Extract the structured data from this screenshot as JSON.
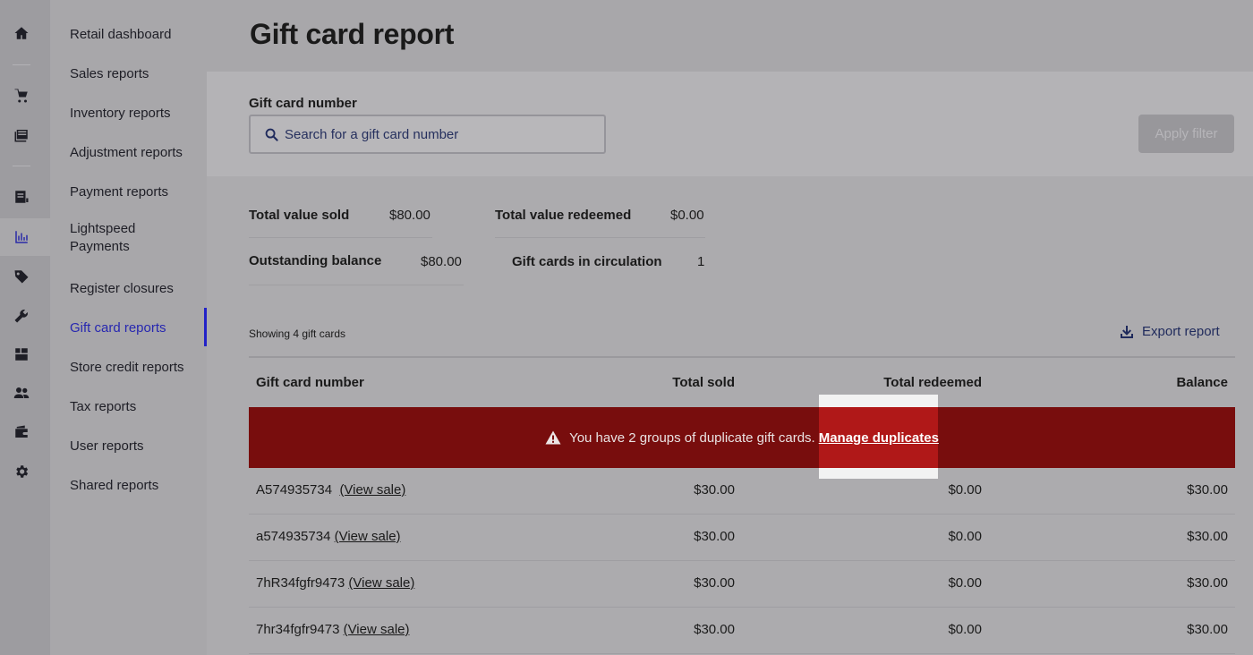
{
  "rail": {
    "icons": [
      "home-icon",
      "cart-icon",
      "catalog-icon",
      "register-icon",
      "reports-icon",
      "tag-icon",
      "wrench-icon",
      "inventory-icon",
      "customers-icon",
      "wallet-icon",
      "gear-icon"
    ],
    "active": "reports-icon"
  },
  "subnav": {
    "items": [
      {
        "label": "Retail dashboard"
      },
      {
        "label": "Sales reports"
      },
      {
        "label": "Inventory reports"
      },
      {
        "label": "Adjustment reports"
      },
      {
        "label": "Payment reports"
      },
      {
        "label": "Lightspeed Payments"
      },
      {
        "label": "Register closures"
      },
      {
        "label": "Gift card reports"
      },
      {
        "label": "Store credit reports"
      },
      {
        "label": "Tax reports"
      },
      {
        "label": "User reports"
      },
      {
        "label": "Shared reports"
      }
    ],
    "active": "Gift card reports"
  },
  "page": {
    "title": "Gift card report"
  },
  "filter": {
    "label": "Gift card number",
    "placeholder": "Search for a gift card number",
    "value": "",
    "apply_label": "Apply filter"
  },
  "summary": {
    "total_sold_label": "Total value sold",
    "total_sold_value": "$80.00",
    "total_redeemed_label": "Total value redeemed",
    "total_redeemed_value": "$0.00",
    "outstanding_label": "Outstanding balance",
    "outstanding_value": "$80.00",
    "circulation_label": "Gift cards in circulation",
    "circulation_value": "1"
  },
  "table": {
    "showing_text": "Showing 4 gift cards",
    "export_label": "Export report",
    "columns": [
      "Gift card number",
      "Total sold",
      "Total redeemed",
      "Balance"
    ],
    "alert": {
      "text": "You have 2 groups of duplicate gift cards.",
      "link": "Manage duplicates"
    },
    "rows": [
      {
        "number": "A574935734",
        "spacer": "  ",
        "link": "(View sale)",
        "sold": "$30.00",
        "redeemed": "$0.00",
        "balance": "$30.00"
      },
      {
        "number": "a574935734",
        "spacer": " ",
        "link": "(View sale)",
        "sold": "$30.00",
        "redeemed": "$0.00",
        "balance": "$30.00"
      },
      {
        "number": "7hR34fgfr9473",
        "spacer": " ",
        "link": "(View sale)",
        "sold": "$30.00",
        "redeemed": "$0.00",
        "balance": "$30.00"
      },
      {
        "number": "7hr34fgfr9473",
        "spacer": " ",
        "link": "(View sale)",
        "sold": "$30.00",
        "redeemed": "$0.00",
        "balance": "$30.00"
      }
    ]
  },
  "colors": {
    "accent": "#2727b0",
    "alert_bg": "#780d0d"
  }
}
